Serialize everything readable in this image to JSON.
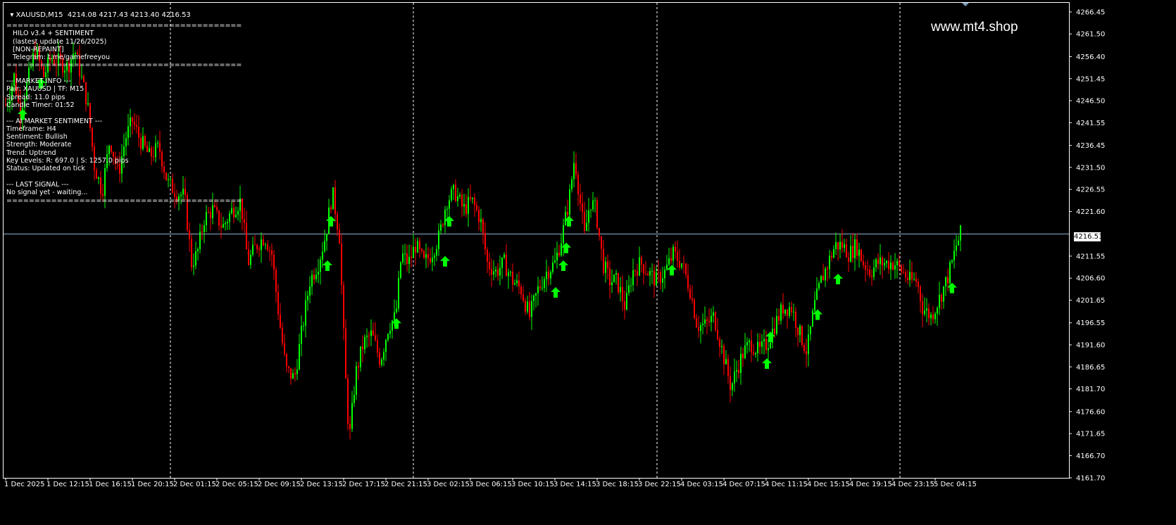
{
  "header": {
    "symbol": "XAUUSD,M15",
    "ohlc": "4214.08 4217.43 4213.40 4216.53"
  },
  "indicator_panel": {
    "lines": [
      "==========================================",
      "   HILO v3.4 + SENTIMENT",
      "   (lastest update 11/26/2025)",
      "   [NON-REPAINT]",
      "   Telegram: t.me/gamefreeyou",
      "==========================================",
      "",
      "--- MARKET INFO ---",
      "Pair: XAUUSD | TF: M15",
      "Spread: 11.0 pips",
      "Candle Timer: 01:52",
      "",
      "--- AI MARKET SENTIMENT ---",
      "Timeframe: H4",
      "Sentiment: Bullish",
      "Strength: Moderate",
      "Trend: Uptrend",
      "Key Levels: R: 697.0 | S: 1257.0 pips",
      "Status: Updated on tick",
      "",
      "--- LAST SIGNAL ---",
      "No signal yet - waiting...",
      "=========================================="
    ]
  },
  "watermark": "www.mt4.shop",
  "current_price_label": "4216.53",
  "colors": {
    "background": "#000000",
    "bull_candle": "#00ff00",
    "bear_candle": "#ff0000",
    "signal_arrow": "#00ff00",
    "grid": "#ffffff",
    "price_line": "#8fb0d0"
  },
  "chart_data": {
    "type": "candlestick",
    "symbol": "XAUUSD",
    "timeframe": "M15",
    "ylim": [
      4161.7,
      4268.5
    ],
    "y_ticks": [
      "4266.45",
      "4261.50",
      "4256.40",
      "4251.45",
      "4246.50",
      "4241.55",
      "4236.45",
      "4231.50",
      "4226.55",
      "4221.60",
      "4216.53",
      "4211.55",
      "4206.60",
      "4201.65",
      "4196.55",
      "4191.60",
      "4186.65",
      "4181.70",
      "4176.60",
      "4171.65",
      "4166.70",
      "4161.70"
    ],
    "x_ticks": [
      "1 Dec 2025",
      "1 Dec 12:15",
      "1 Dec 16:15",
      "1 Dec 20:15",
      "2 Dec 01:15",
      "2 Dec 05:15",
      "2 Dec 09:15",
      "2 Dec 13:15",
      "2 Dec 17:15",
      "2 Dec 21:15",
      "3 Dec 02:15",
      "3 Dec 06:15",
      "3 Dec 10:15",
      "3 Dec 14:15",
      "3 Dec 18:15",
      "3 Dec 22:15",
      "4 Dec 03:15",
      "4 Dec 07:15",
      "4 Dec 11:15",
      "4 Dec 15:15",
      "4 Dec 19:15",
      "4 Dec 23:15",
      "5 Dec 04:15"
    ],
    "day_separators": [
      "2 Dec",
      "3 Dec",
      "4 Dec",
      "5 Dec"
    ],
    "current_price": 4216.53,
    "price_path": [
      [
        0,
        4244
      ],
      [
        10,
        4246
      ],
      [
        20,
        4252
      ],
      [
        28,
        4244
      ],
      [
        38,
        4250
      ],
      [
        50,
        4258
      ],
      [
        62,
        4252
      ],
      [
        72,
        4256
      ],
      [
        86,
        4255
      ],
      [
        96,
        4254
      ],
      [
        106,
        4258
      ],
      [
        115,
        4252
      ],
      [
        124,
        4246
      ],
      [
        134,
        4232
      ],
      [
        145,
        4226
      ],
      [
        156,
        4238
      ],
      [
        168,
        4230
      ],
      [
        178,
        4238
      ],
      [
        188,
        4242
      ],
      [
        198,
        4238
      ],
      [
        212,
        4234
      ],
      [
        226,
        4236
      ],
      [
        238,
        4228
      ],
      [
        250,
        4226
      ],
      [
        262,
        4225
      ],
      [
        272,
        4210
      ],
      [
        280,
        4212
      ],
      [
        290,
        4220
      ],
      [
        302,
        4222
      ],
      [
        316,
        4218
      ],
      [
        330,
        4222
      ],
      [
        342,
        4224
      ],
      [
        352,
        4210
      ],
      [
        364,
        4214
      ],
      [
        376,
        4216
      ],
      [
        386,
        4212
      ],
      [
        396,
        4198
      ],
      [
        406,
        4186
      ],
      [
        418,
        4184
      ],
      [
        430,
        4196
      ],
      [
        440,
        4206
      ],
      [
        452,
        4210
      ],
      [
        462,
        4216
      ],
      [
        472,
        4226
      ],
      [
        482,
        4216
      ],
      [
        490,
        4186
      ],
      [
        496,
        4170
      ],
      [
        505,
        4185
      ],
      [
        516,
        4192
      ],
      [
        528,
        4194
      ],
      [
        540,
        4188
      ],
      [
        552,
        4196
      ],
      [
        562,
        4198
      ],
      [
        570,
        4212
      ],
      [
        580,
        4210
      ],
      [
        590,
        4214
      ],
      [
        602,
        4210
      ],
      [
        612,
        4212
      ],
      [
        624,
        4216
      ],
      [
        634,
        4224
      ],
      [
        646,
        4226
      ],
      [
        658,
        4222
      ],
      [
        670,
        4224
      ],
      [
        682,
        4220
      ],
      [
        692,
        4210
      ],
      [
        704,
        4208
      ],
      [
        716,
        4210
      ],
      [
        728,
        4206
      ],
      [
        740,
        4204
      ],
      [
        752,
        4198
      ],
      [
        764,
        4204
      ],
      [
        776,
        4208
      ],
      [
        788,
        4210
      ],
      [
        798,
        4216
      ],
      [
        808,
        4224
      ],
      [
        816,
        4234
      ],
      [
        822,
        4226
      ],
      [
        830,
        4216
      ],
      [
        838,
        4224
      ],
      [
        846,
        4222
      ],
      [
        856,
        4210
      ],
      [
        866,
        4206
      ],
      [
        876,
        4206
      ],
      [
        888,
        4200
      ],
      [
        898,
        4208
      ],
      [
        910,
        4210
      ],
      [
        920,
        4208
      ],
      [
        932,
        4206
      ],
      [
        944,
        4208
      ],
      [
        956,
        4212
      ],
      [
        968,
        4210
      ],
      [
        980,
        4204
      ],
      [
        990,
        4196
      ],
      [
        1002,
        4196
      ],
      [
        1014,
        4198
      ],
      [
        1026,
        4190
      ],
      [
        1038,
        4182
      ],
      [
        1046,
        4186
      ],
      [
        1056,
        4190
      ],
      [
        1066,
        4192
      ],
      [
        1078,
        4190
      ],
      [
        1090,
        4192
      ],
      [
        1100,
        4196
      ],
      [
        1112,
        4200
      ],
      [
        1124,
        4200
      ],
      [
        1136,
        4194
      ],
      [
        1146,
        4190
      ],
      [
        1156,
        4200
      ],
      [
        1166,
        4206
      ],
      [
        1176,
        4210
      ],
      [
        1186,
        4214
      ],
      [
        1196,
        4214
      ],
      [
        1206,
        4212
      ],
      [
        1216,
        4214
      ],
      [
        1226,
        4210
      ],
      [
        1236,
        4208
      ],
      [
        1246,
        4210
      ],
      [
        1258,
        4210
      ],
      [
        1270,
        4210
      ],
      [
        1282,
        4208
      ],
      [
        1292,
        4206
      ],
      [
        1302,
        4206
      ],
      [
        1310,
        4200
      ],
      [
        1322,
        4198
      ],
      [
        1334,
        4202
      ],
      [
        1344,
        4206
      ],
      [
        1352,
        4210
      ],
      [
        1358,
        4214
      ],
      [
        1364,
        4216.5
      ]
    ],
    "signal_arrows": [
      {
        "bar_x": 32,
        "price": 4243
      },
      {
        "bar_x": 58,
        "price": 4250
      },
      {
        "bar_x": 470,
        "price": 4219
      },
      {
        "bar_x": 465,
        "price": 4209
      },
      {
        "bar_x": 563,
        "price": 4196
      },
      {
        "bar_x": 632,
        "price": 4210
      },
      {
        "bar_x": 638,
        "price": 4219
      },
      {
        "bar_x": 789,
        "price": 4203
      },
      {
        "bar_x": 800,
        "price": 4209
      },
      {
        "bar_x": 804,
        "price": 4213
      },
      {
        "bar_x": 808,
        "price": 4219
      },
      {
        "bar_x": 954,
        "price": 4208
      },
      {
        "bar_x": 1089,
        "price": 4187
      },
      {
        "bar_x": 1094,
        "price": 4193
      },
      {
        "bar_x": 1161,
        "price": 4198
      },
      {
        "bar_x": 1190,
        "price": 4206
      },
      {
        "bar_x": 1352,
        "price": 4204
      }
    ]
  }
}
